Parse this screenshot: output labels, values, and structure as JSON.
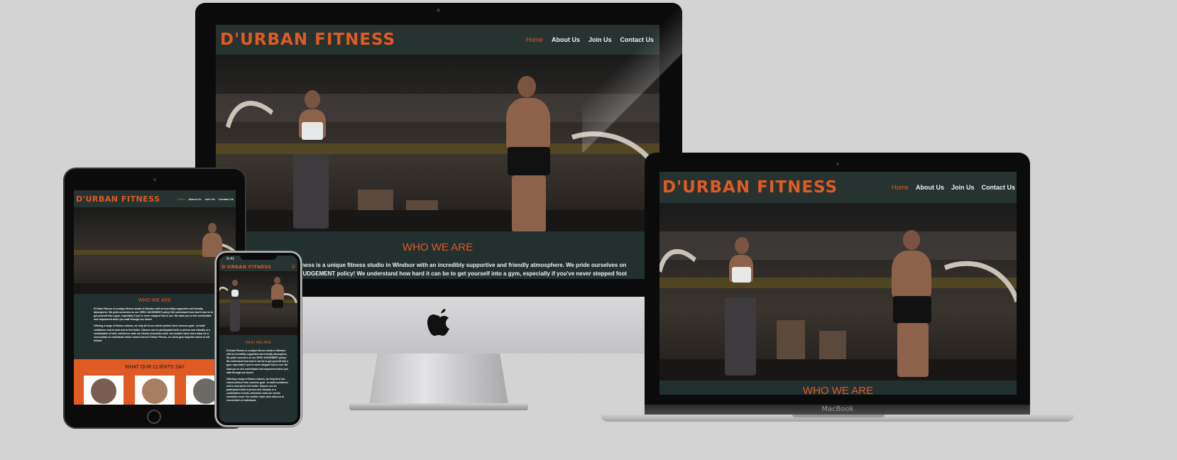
{
  "site": {
    "logo": "D'URBAN FITNESS",
    "nav": [
      "Home",
      "About Us",
      "Join Us",
      "Contact Us"
    ],
    "who_title": "WHO WE ARE",
    "desktop_text_line1": "tness is a unique fitness studio in Windsor with an incredibly supportive and friendly atmosphere. We pride ourselves on",
    "desktop_text_line2": "JUDGEMENT policy! We understand how hard it can be to get yourself into a gym, especially if you've never stepped foot",
    "clients_title": "WHAT OUR CLIENTS SAY",
    "accent": "#e05a24",
    "dark": "#233030"
  },
  "tablet": {
    "para1": "D'Urban Fitness is a unique fitness studio in Windsor with an incredibly supportive and friendly atmosphere. We pride ourselves on our ZERO JUDGEMENT policy! We understand how hard it can be to get yourself into a gym, especially if you've never stepped foot in one. We want you to feel comfortable and empowered when you walk through our doors!",
    "para2": "Offering a range of fitness classes, we help all of our clients achieve their common goal - to build confidence and to look and to feel better. Classes can be participated both in person and virtually or a combination of both, whichever suits our clients schedules most. Our smaller class sizes allow us to concentrate on individuals which means that at D'Urban Fitness, no client gets forgotten about or left behind."
  },
  "phone": {
    "time": "9:41",
    "para1": "D'Urban Fitness is a unique fitness studio in Windsor with an incredibly supportive and friendly atmosphere. We pride ourselves on our ZERO JUDGEMENT policy! We understand how hard it can be to get yourself into a gym, especially if you've never stepped foot in one. We want you to feel comfortable and empowered when you walk through our doors!",
    "para2": "Offering a range of fitness classes, we help all of our clients achieve their common goal - to build confidence and to look and to feel better. Classes can be participated both in person and virtually or a combination of both, whichever suits our clients schedules most. Our smaller class sizes allow us to concentrate on individuals"
  },
  "macbook_label": "MacBook",
  "icons": {
    "apple": "apple-logo-icon",
    "camera": "camera-icon",
    "home": "home-button-icon",
    "menu": "hamburger-menu-icon"
  }
}
